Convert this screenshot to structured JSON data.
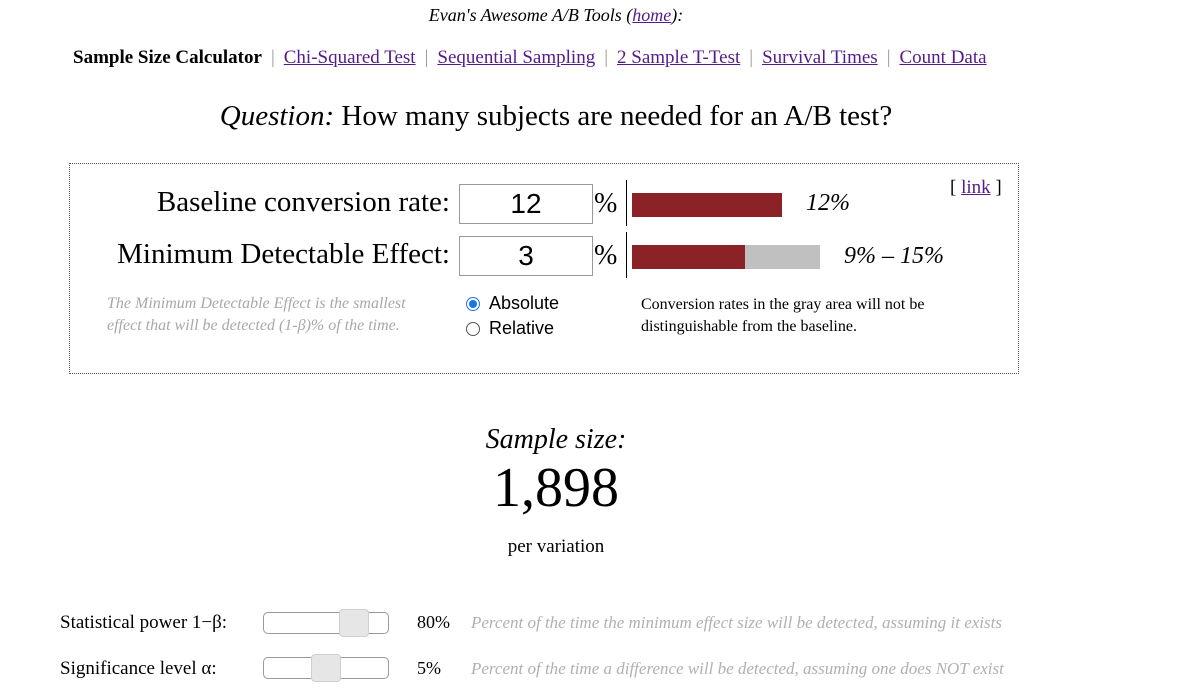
{
  "header": {
    "title_prefix": "Evan's Awesome A/B Tools (",
    "home_link": "home",
    "title_suffix": "):"
  },
  "nav": {
    "items": [
      {
        "label": "Sample Size Calculator",
        "current": true
      },
      {
        "label": "Chi-Squared Test",
        "current": false
      },
      {
        "label": "Sequential Sampling",
        "current": false
      },
      {
        "label": "2 Sample T-Test",
        "current": false
      },
      {
        "label": "Survival Times",
        "current": false
      },
      {
        "label": "Count Data",
        "current": false
      }
    ],
    "separator": "|"
  },
  "question": {
    "prefix": "Question:",
    "text": "How many subjects are needed for an A/B test?"
  },
  "calculator": {
    "link": "link",
    "link_open": "[",
    "link_close": "]",
    "baseline": {
      "label": "Baseline conversion rate:",
      "value": "12",
      "unit": "%",
      "bar_label": "12%",
      "bar_fraction": 1.0
    },
    "mde": {
      "label": "Minimum Detectable Effect:",
      "value": "3",
      "unit": "%",
      "bar_label": "9% – 15%",
      "dark_fraction": 0.75,
      "gray_fraction": 0.5
    },
    "mde_note_line1": "The Minimum Detectable Effect is the smallest",
    "mde_note_line2": "effect that will be detected (1-β)% of the time.",
    "mode_options": [
      {
        "label": "Absolute",
        "selected": true
      },
      {
        "label": "Relative",
        "selected": false
      }
    ],
    "gray_note_line1": "Conversion rates in the gray area will not be",
    "gray_note_line2": "distinguishable from the baseline."
  },
  "result": {
    "heading": "Sample size:",
    "value": "1,898",
    "unit": "per variation"
  },
  "power": {
    "label": "Statistical power 1−β:",
    "value": "80%",
    "slider_fraction": 0.8,
    "note": "Percent of the time the minimum effect size will be detected, assuming it exists"
  },
  "significance": {
    "label": "Significance level α:",
    "value": "5%",
    "slider_fraction": 0.5,
    "note": "Percent of the time a difference will be detected, assuming one does NOT exist"
  },
  "colors": {
    "bar_dark": "#8b2226",
    "bar_gray": "#c0c0c0",
    "link": "#551a8b",
    "radio_selected": "#1a73e8"
  }
}
